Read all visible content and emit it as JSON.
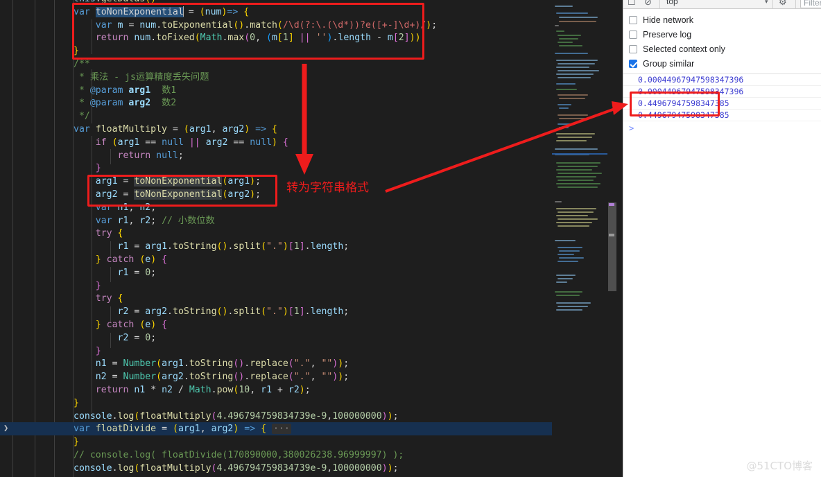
{
  "editor": {
    "language": "javascript",
    "theme": "Dark+",
    "lines": [
      "  this.getDatas()",
      "var toNonExponential = (num)=> {",
      "    var m = num.toExponential().match(/\\d(?:\\.(\\d*))?e([+-]\\d+)/);",
      "    return num.toFixed(Math.max(0, (m[1] || '').length - m[2]));",
      "}",
      "/**",
      " * 乘法 - js运算精度丢失问题",
      " * @param arg1  数1",
      " * @param arg2  数2",
      " */",
      "var floatMultiply = (arg1, arg2) => {",
      "    if (arg1 == null || arg2 == null) {",
      "        return null;",
      "    }",
      "    arg1 = toNonExponential(arg1);",
      "    arg2 = toNonExponential(arg2);",
      "    var n1, n2;",
      "    var r1, r2; // 小数位数",
      "    try {",
      "        r1 = arg1.toString().split(\".\")[1].length;",
      "    } catch (e) {",
      "        r1 = 0;",
      "    }",
      "    try {",
      "        r2 = arg2.toString().split(\".\")[1].length;",
      "    } catch (e) {",
      "        r2 = 0;",
      "    }",
      "    n1 = Number(arg1.toString().replace(\".\", \"\"));",
      "    n2 = Number(arg2.toString().replace(\".\", \"\"));",
      "    return n1 * n2 / Math.pow(10, r1 + r2);",
      "}",
      "console.log(floatMultiply(4.496794759834739e-9,100000000));",
      "var floatDivide = (arg1, arg2) => {···",
      "}",
      "// console.log( floatDivide(170890000,380026238.96999997) );",
      "console.log(floatMultiply(4.496794759834739e-9,100000000));"
    ],
    "selected_word": "toNonExponential",
    "active_line_text": "var floatDivide = (arg1, arg2) => {···",
    "fold_marker": "···",
    "gutter_fold_icon": "chevron-right-icon"
  },
  "devtools": {
    "toolbar": {
      "device_toolbar_icon": "device-toolbar-icon",
      "clear_console_icon": "clear-console-icon",
      "context_selector": "top",
      "context_caret_icon": "chevron-down-icon",
      "filter_settings_icon": "filter-settings-icon",
      "filter_placeholder": "Filter"
    },
    "options": [
      {
        "label": "Hide network",
        "checked": false
      },
      {
        "label": "Preserve log",
        "checked": false
      },
      {
        "label": "Selected context only",
        "checked": false
      },
      {
        "label": "Group similar",
        "checked": true
      }
    ],
    "console_messages": [
      "0.00044967947598347396",
      "0.00044967947598347396",
      "0.44967947598347385",
      "0.44967947598347385"
    ],
    "prompt_symbol": ">",
    "highlighted_message_indices": [
      2,
      3
    ]
  },
  "annotations": {
    "top_box_label": "toNonExponential-definition-highlight",
    "mid_box_label": "toNonExponential-calls-highlight",
    "console_box_label": "console-result-highlight",
    "callout_text": "转为字符串格式",
    "down_arrow": "down-arrow-annotation",
    "pointer_arrow": "pointer-arrow-annotation"
  },
  "watermark": {
    "text": "@51CTO博客"
  },
  "colors": {
    "annotation_red": "#ee1c1c",
    "editor_bg": "#1e1e1e",
    "devtools_bg": "#ffffff",
    "console_value": "#3b3bd1",
    "accent_blue": "#1a73e8"
  }
}
